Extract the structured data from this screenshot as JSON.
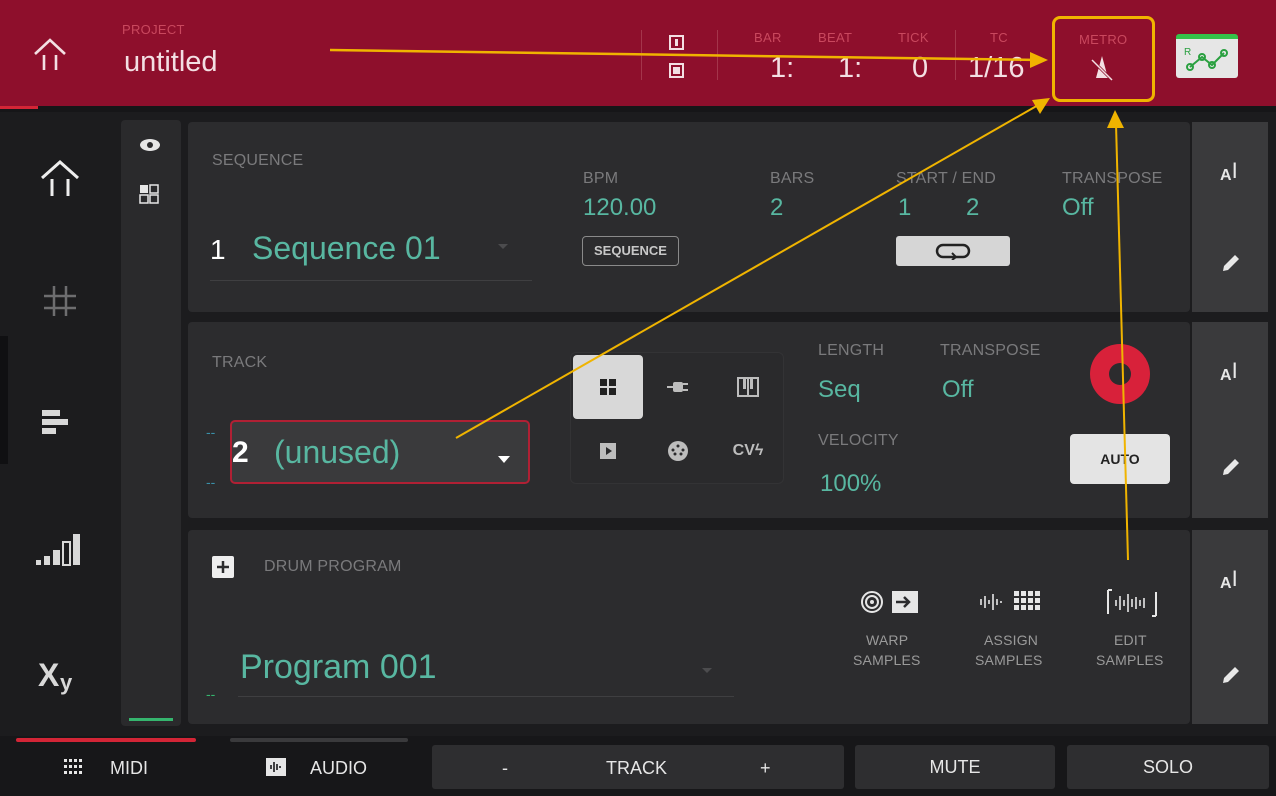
{
  "header": {
    "project_label": "PROJECT",
    "project_name": "untitled",
    "bar_label": "BAR",
    "beat_label": "BEAT",
    "tick_label": "TICK",
    "tc_label": "TC",
    "metro_label": "METRO",
    "bar_value": "1:",
    "beat_value": "1:",
    "tick_value": "0",
    "tc_value": "1/16",
    "r_label": "R"
  },
  "sequence": {
    "label": "SEQUENCE",
    "number": "1",
    "name": "Sequence 01",
    "bpm_label": "BPM",
    "bpm_value": "120.00",
    "bpm_button": "SEQUENCE",
    "bars_label": "BARS",
    "bars_value": "2",
    "start_end_label": "START / END",
    "start_value": "1",
    "end_value": "2",
    "transpose_label": "TRANSPOSE",
    "transpose_value": "Off"
  },
  "track": {
    "label": "TRACK",
    "number": "2",
    "name": "(unused)",
    "dash_top": "--",
    "dash_bottom": "--",
    "length_label": "LENGTH",
    "length_value": "Seq",
    "transpose_label": "TRANSPOSE",
    "transpose_value": "Off",
    "velocity_label": "VELOCITY",
    "velocity_value": "100%",
    "auto_button": "AUTO",
    "cv_label": "CVϟ"
  },
  "program": {
    "label": "DRUM PROGRAM",
    "name": "Program 001",
    "dash": "--",
    "warp_label_1": "WARP",
    "warp_label_2": "SAMPLES",
    "assign_label_1": "ASSIGN",
    "assign_label_2": "SAMPLES",
    "edit_label_1": "EDIT",
    "edit_label_2": "SAMPLES"
  },
  "bottom": {
    "midi": "MIDI",
    "audio": "AUDIO",
    "minus": "-",
    "track": "TRACK",
    "plus": "+",
    "mute": "MUTE",
    "solo": "SOLO"
  },
  "colors": {
    "header": "#8e0f2c",
    "accent": "#58b7a1",
    "highlight": "#f0b400"
  },
  "icons": [
    "home-icon",
    "grid-icon",
    "mixer-icon",
    "levels-icon",
    "xy-icon",
    "eye-icon",
    "metronome-icon",
    "automation-icon",
    "rename-icon",
    "edit-icon",
    "loop-icon",
    "record-icon"
  ]
}
